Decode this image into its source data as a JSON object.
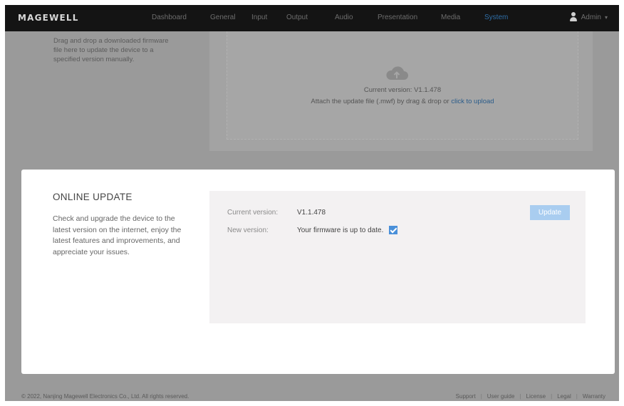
{
  "nav": {
    "logo": "MAGEWELL",
    "items": [
      {
        "label": "Dashboard",
        "active": false
      },
      {
        "label": "General",
        "active": false
      },
      {
        "label": "Input",
        "active": false
      },
      {
        "label": "Output",
        "active": false
      },
      {
        "label": "Audio",
        "active": false
      },
      {
        "label": "Presentation",
        "active": false
      },
      {
        "label": "Media",
        "active": false
      },
      {
        "label": "System",
        "active": true
      }
    ],
    "user_label": "Admin"
  },
  "manual_update": {
    "description": "Drag and drop a downloaded firmware file here to update the device to a specified version manually.",
    "current_version": "Current version: V1.1.478",
    "attach_prefix": "Attach the update file (.mwf) by drag & drop or ",
    "upload_link": "click to upload"
  },
  "online_update": {
    "title": "ONLINE UPDATE",
    "description": "Check and upgrade the device to the latest version on the internet, enjoy the latest features and improvements, and appreciate your issues.",
    "current_version_label": "Current version:",
    "current_version_value": "V1.1.478",
    "new_version_label": "New version:",
    "new_version_value": "Your firmware is up to date.",
    "update_button": "Update"
  },
  "footer": {
    "copyright": "© 2022, Nanjing Magewell Electronics Co., Ltd. All rights reserved.",
    "links": [
      "Support",
      "User guide",
      "License",
      "Legal",
      "Warranty"
    ]
  },
  "colors": {
    "nav_bg": "#141414",
    "active_nav": "#2f6ea7",
    "overlay": "#9a9a9a",
    "button": "#a9cdf0",
    "check": "#4a90d9"
  }
}
